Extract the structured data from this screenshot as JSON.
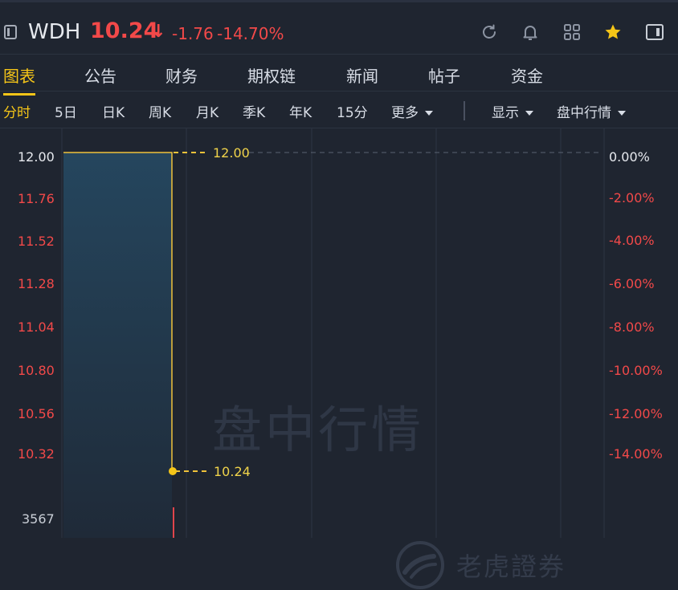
{
  "header": {
    "ticker": "WDH",
    "price": "10.24",
    "arrow": "↓",
    "change": "-1.76",
    "change_pct": "-14.70%",
    "icons": [
      "layout-toggle-icon",
      "refresh-icon",
      "bell-icon",
      "grid-icon",
      "star-icon",
      "panel-toggle-icon"
    ]
  },
  "tabs": [
    "图表",
    "公告",
    "财务",
    "期权链",
    "新闻",
    "帖子",
    "资金"
  ],
  "active_tab": "图表",
  "periods": [
    "分时",
    "5日",
    "日K",
    "周K",
    "月K",
    "季K",
    "年K",
    "15分",
    "更多"
  ],
  "active_period": "分时",
  "controls": {
    "display": "显示",
    "session": "盘中行情"
  },
  "chart": {
    "y_left": [
      "12.00",
      "11.76",
      "11.52",
      "11.28",
      "11.04",
      "10.80",
      "10.56",
      "10.32"
    ],
    "y_right": [
      "0.00%",
      "-2.00%",
      "-4.00%",
      "-6.00%",
      "-8.00%",
      "-10.00%",
      "-12.00%",
      "-14.00%"
    ],
    "high_label": "12.00",
    "low_label": "10.24",
    "volume_label": "3567",
    "watermark": "盘中行情",
    "brand_watermark": "老虎證券"
  },
  "chart_data": {
    "type": "line",
    "series": [
      {
        "name": "",
        "values": [
          12.0,
          12.0,
          10.24
        ]
      }
    ],
    "prev_close": 12.0,
    "last": 10.24,
    "ylim": [
      10.24,
      12.0
    ],
    "y_tick_labels": [
      "12.00",
      "11.76",
      "11.52",
      "11.28",
      "11.04",
      "10.80",
      "10.56",
      "10.32"
    ],
    "y2_tick_labels": [
      "0.00%",
      "-2.00%",
      "-4.00%",
      "-6.00%",
      "-8.00%",
      "-10.00%",
      "-12.00%",
      "-14.00%"
    ],
    "volume": 3567
  },
  "colors": {
    "up": "#f24949",
    "accent": "#f5c518",
    "bg": "#1f2530",
    "line": "#f0c23a"
  }
}
